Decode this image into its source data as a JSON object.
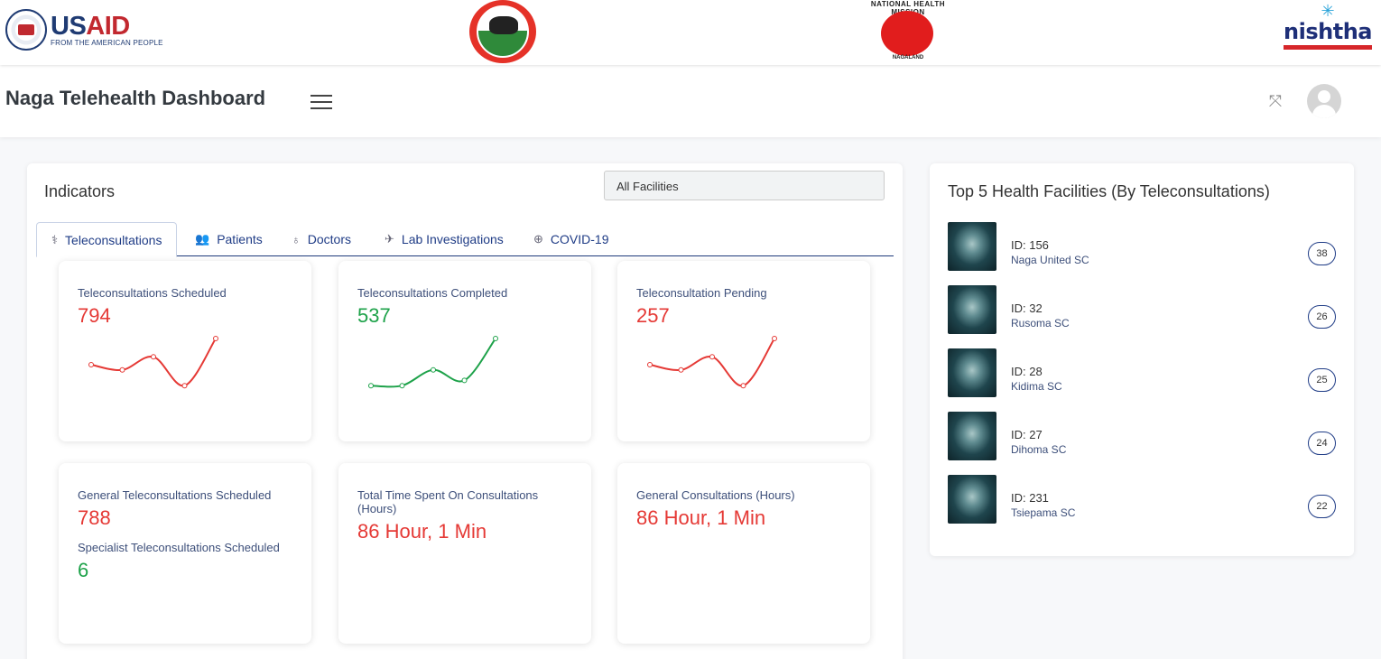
{
  "logos": {
    "usaid_title": "USAID",
    "usaid_tagline": "FROM THE AMERICAN PEOPLE",
    "nhm_arc": "NATIONAL HEALTH MISSION",
    "nhm_bottom": "NAGALAND",
    "nishtha_word": "nishtha"
  },
  "header": {
    "title": "Naga Telehealth Dashboard"
  },
  "indicators": {
    "title": "Indicators",
    "facility_select": "All Facilities",
    "tabs": [
      {
        "label": "Teleconsultations",
        "icon": "stethoscope-icon",
        "active": true
      },
      {
        "label": "Patients",
        "icon": "users-icon",
        "active": false
      },
      {
        "label": "Doctors",
        "icon": "stethoscope-icon",
        "active": false
      },
      {
        "label": "Lab Investigations",
        "icon": "flask-icon",
        "active": false
      },
      {
        "label": "COVID-19",
        "icon": "globe-icon",
        "active": false
      }
    ],
    "metrics": [
      {
        "label": "Teleconsultations Scheduled",
        "value": "794",
        "color": "#e53935",
        "spark": [
          5,
          4,
          6.5,
          1,
          10
        ]
      },
      {
        "label": "Teleconsultations Completed",
        "value": "537",
        "color": "#1ea24a",
        "spark": [
          1,
          1,
          4,
          2,
          10
        ]
      },
      {
        "label": "Teleconsultation Pending",
        "value": "257",
        "color": "#e53935",
        "spark": [
          5,
          4,
          6.5,
          1,
          10
        ]
      },
      {
        "label": "General Teleconsultations Scheduled",
        "value": "788",
        "color": "#e53935",
        "sub_label": "Specialist Teleconsultations Scheduled",
        "sub_value": "6",
        "sub_color": "#1ea24a"
      },
      {
        "label": "Total Time Spent On Consultations (Hours)",
        "value": "86 Hour, 1 Min",
        "color": "#e53935"
      },
      {
        "label": "General Consultations (Hours)",
        "value": "86 Hour, 1 Min",
        "color": "#e53935"
      }
    ]
  },
  "top_facilities": {
    "title": "Top 5 Health Facilities (By Teleconsultations)",
    "items": [
      {
        "id": "ID: 156",
        "name": "Naga United SC",
        "count": "38"
      },
      {
        "id": "ID: 32",
        "name": "Rusoma SC",
        "count": "26"
      },
      {
        "id": "ID: 28",
        "name": "Kidima SC",
        "count": "25"
      },
      {
        "id": "ID: 27",
        "name": "Dihoma SC",
        "count": "24"
      },
      {
        "id": "ID: 231",
        "name": "Tsiepama SC",
        "count": "22"
      }
    ]
  }
}
